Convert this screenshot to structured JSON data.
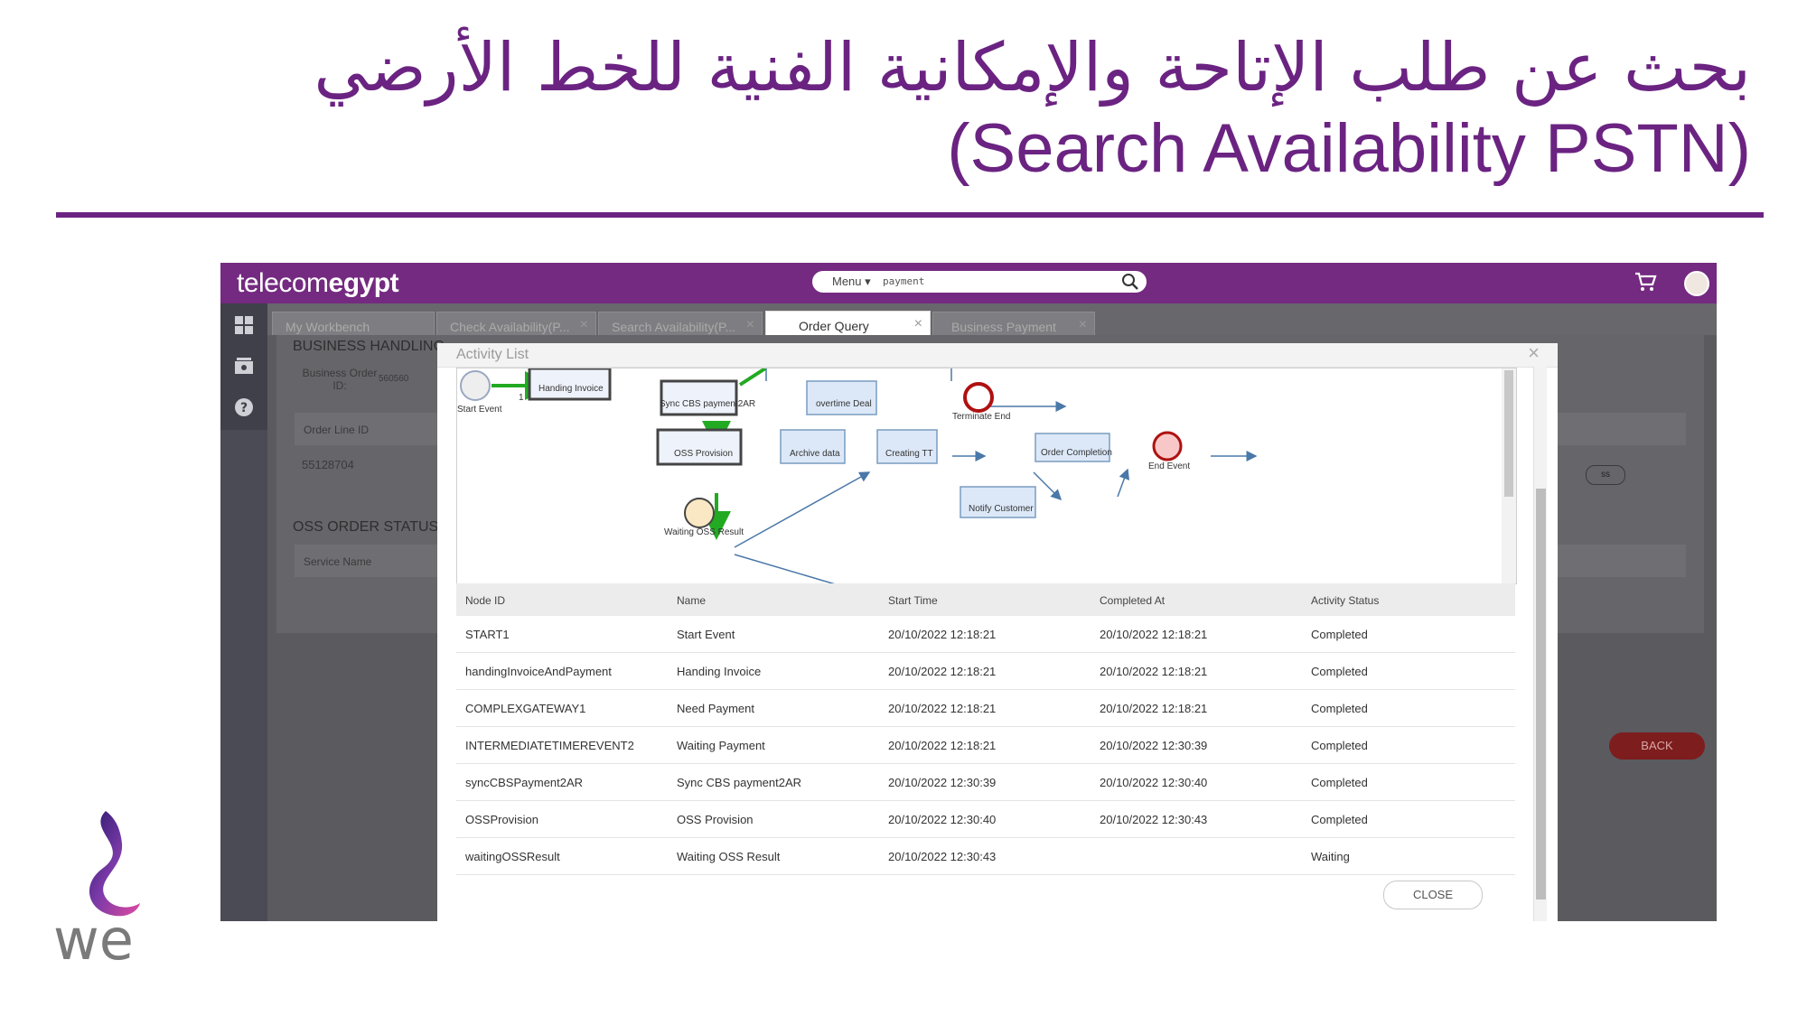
{
  "slide": {
    "title_arabic": "بحث عن طلب الإتاحة والإمكانية الفنية للخط الأرضي",
    "title_english": "(Search Availability PSTN)",
    "logo_text": "we",
    "brand_color": "#6b2382"
  },
  "app": {
    "brand_light": "telecom",
    "brand_bold": "egypt",
    "search": {
      "menu_label": "Menu ▾",
      "query": "payment"
    },
    "icons": [
      "search-icon",
      "cart-icon",
      "avatar",
      "workbench-icon",
      "monitor-icon",
      "help-icon"
    ]
  },
  "tabs": [
    {
      "label": "My Workbench"
    },
    {
      "label": "Check Availability(P..."
    },
    {
      "label": "Search Availability(P..."
    },
    {
      "label": "Order Query"
    },
    {
      "label": "Business Payment"
    }
  ],
  "background": {
    "heading1": "BUSINESS HANDLING",
    "order_id_label": "Business Order ID:",
    "order_id_value": "560560",
    "order_line_label": "Order Line ID",
    "order_line_value": "55128704",
    "heading2": "OSS ORDER STATUS",
    "service_label": "Service Name",
    "pill_text": "ss",
    "back_label": "BACK"
  },
  "modal": {
    "title": "Activity List",
    "close_label": "CLOSE",
    "diagram": {
      "nodes": [
        {
          "label": "Start Event"
        },
        {
          "label": "Handing Invoice"
        },
        {
          "label": "Sync CBS payment2AR"
        },
        {
          "label": "OSS Provision"
        },
        {
          "label": "Waiting OSS Result"
        },
        {
          "label": "overtime Deal"
        },
        {
          "label": "Terminate End"
        },
        {
          "label": "Archive data"
        },
        {
          "label": "Creating TT"
        },
        {
          "label": "Notify Customer"
        },
        {
          "label": "Order Completion"
        },
        {
          "label": "End Event"
        }
      ],
      "edge_label": "1"
    },
    "columns": [
      "Node ID",
      "Name",
      "Start Time",
      "Completed At",
      "Activity Status"
    ],
    "rows": [
      [
        "START1",
        "Start Event",
        "20/10/2022 12:18:21",
        "20/10/2022 12:18:21",
        "Completed"
      ],
      [
        "handingInvoiceAndPayment",
        "Handing Invoice",
        "20/10/2022 12:18:21",
        "20/10/2022 12:18:21",
        "Completed"
      ],
      [
        "COMPLEXGATEWAY1",
        "Need Payment",
        "20/10/2022 12:18:21",
        "20/10/2022 12:18:21",
        "Completed"
      ],
      [
        "INTERMEDIATETIMEREVENT2",
        "Waiting Payment",
        "20/10/2022 12:18:21",
        "20/10/2022 12:30:39",
        "Completed"
      ],
      [
        "syncCBSPayment2AR",
        "Sync CBS payment2AR",
        "20/10/2022 12:30:39",
        "20/10/2022 12:30:40",
        "Completed"
      ],
      [
        "OSSProvision",
        "OSS Provision",
        "20/10/2022 12:30:40",
        "20/10/2022 12:30:43",
        "Completed"
      ],
      [
        "waitingOSSResult",
        "Waiting OSS Result",
        "20/10/2022 12:30:43",
        "",
        "Waiting"
      ]
    ]
  }
}
